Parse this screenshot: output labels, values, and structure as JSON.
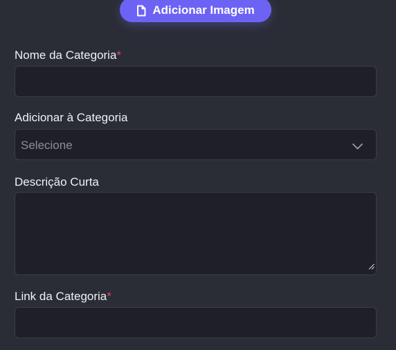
{
  "add_image_button": {
    "label": "Adicionar Imagem",
    "icon": "file-icon",
    "color": "#6c63f5"
  },
  "fields": {
    "category_name": {
      "label": "Nome da Categoria",
      "required_mark": "*",
      "value": ""
    },
    "parent_category": {
      "label": "Adicionar à Categoria",
      "selected": "Selecione",
      "icon": "chevron-down-icon"
    },
    "short_description": {
      "label": "Descrição Curta",
      "value": ""
    },
    "category_link": {
      "label": "Link da Categoria",
      "required_mark": "*",
      "value": ""
    }
  },
  "colors": {
    "background": "#2a2d35",
    "input_background": "#1f2027",
    "input_border": "#3b3e48",
    "required": "#e0455f"
  }
}
